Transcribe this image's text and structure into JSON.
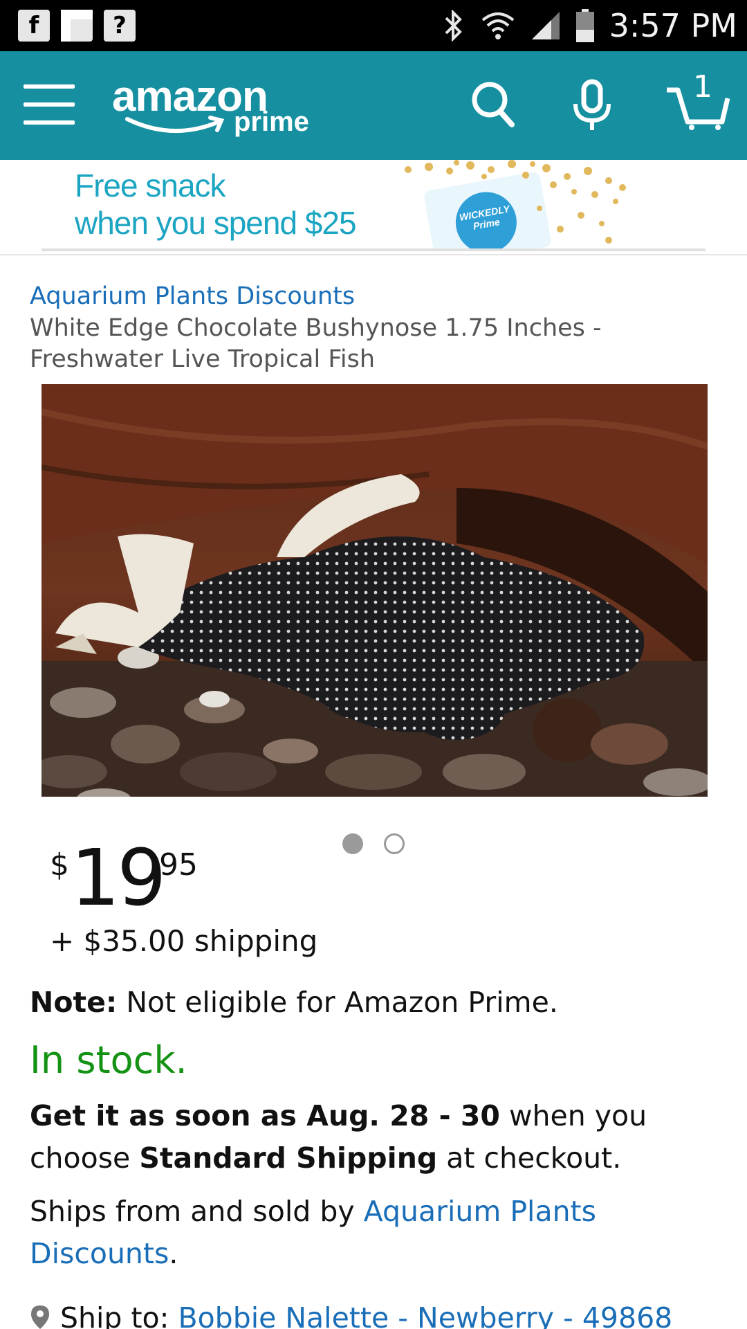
{
  "status_bar": {
    "time": "3:57 PM",
    "notification_icons": [
      "f",
      "?"
    ]
  },
  "header": {
    "logo_main": "amazon",
    "logo_sub": "prime",
    "cart_count": "1",
    "colors": {
      "header_bg": "#168fa0"
    }
  },
  "banner": {
    "line1": "Free snack",
    "line2": "when you spend $25",
    "bag_label": "WICKEDLY Prime"
  },
  "product": {
    "seller": "Aquarium Plants Discounts",
    "title": "White Edge Chocolate Bushynose 1.75 Inches - Freshwater Live Tropical Fish",
    "image_count": 2,
    "active_image": 1
  },
  "price": {
    "symbol": "$",
    "whole": "19",
    "fraction": "95",
    "shipping": "+ $35.00 shipping"
  },
  "note": {
    "label": "Note:",
    "text": " Not eligible for Amazon Prime."
  },
  "stock": {
    "text": "In stock.",
    "color": "#149214"
  },
  "delivery": {
    "bold1": "Get it as soon as Aug. 28 - 30",
    "text1": " when you choose ",
    "bold2": "Standard Shipping",
    "text2": " at checkout."
  },
  "ships": {
    "prefix": "Ships from and sold by ",
    "seller_link": "Aquarium Plants Discounts",
    "suffix": "."
  },
  "ship_to": {
    "label": "Ship to: ",
    "address": "Bobbie Nalette - Newberry - 49868"
  }
}
